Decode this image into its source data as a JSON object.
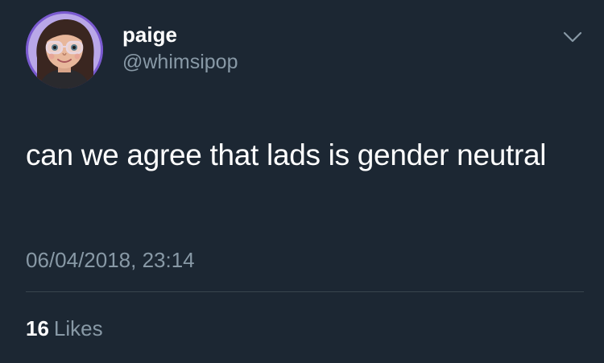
{
  "tweet": {
    "author": {
      "display_name": "paige",
      "handle": "@whimsipop",
      "avatar_icon": "user-avatar-illustration"
    },
    "menu_icon": "chevron-down-icon",
    "text": "can we agree that lads is gender neutral",
    "timestamp": "06/04/2018, 23:14",
    "likes": {
      "count": "16",
      "label": "Likes"
    }
  },
  "colors": {
    "background": "#1c2733",
    "primary_text": "#ffffff",
    "secondary_text": "#8899a6",
    "divider": "#38444d",
    "avatar_ring": "#7a5ad0"
  }
}
